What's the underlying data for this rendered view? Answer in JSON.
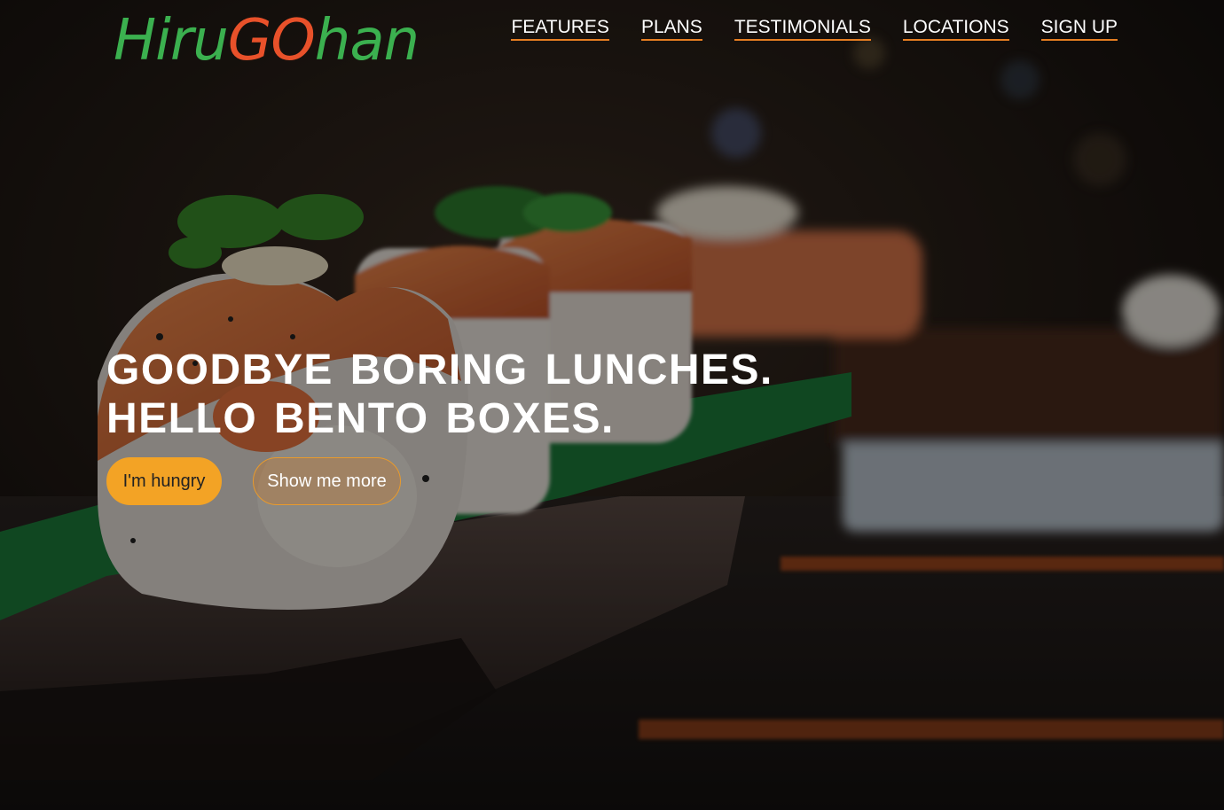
{
  "brand": {
    "logo_part1": "Hiru",
    "logo_part2": "GO",
    "logo_part3": "han",
    "green": "#3bb04f",
    "orange": "#e8512a"
  },
  "nav": {
    "items": [
      {
        "label": "FEATURES"
      },
      {
        "label": "PLANS"
      },
      {
        "label": "TESTIMONIALS"
      },
      {
        "label": "LOCATIONS"
      },
      {
        "label": "SIGN UP"
      }
    ],
    "underline_color": "#e67e22"
  },
  "hero": {
    "headline_line1": "GOODBYE BORING LUNCHES.",
    "headline_line2": "HELLO BENTO BOXES.",
    "primary_button": "I'm hungry",
    "secondary_button": "Show me more",
    "accent": "#f3a325"
  }
}
